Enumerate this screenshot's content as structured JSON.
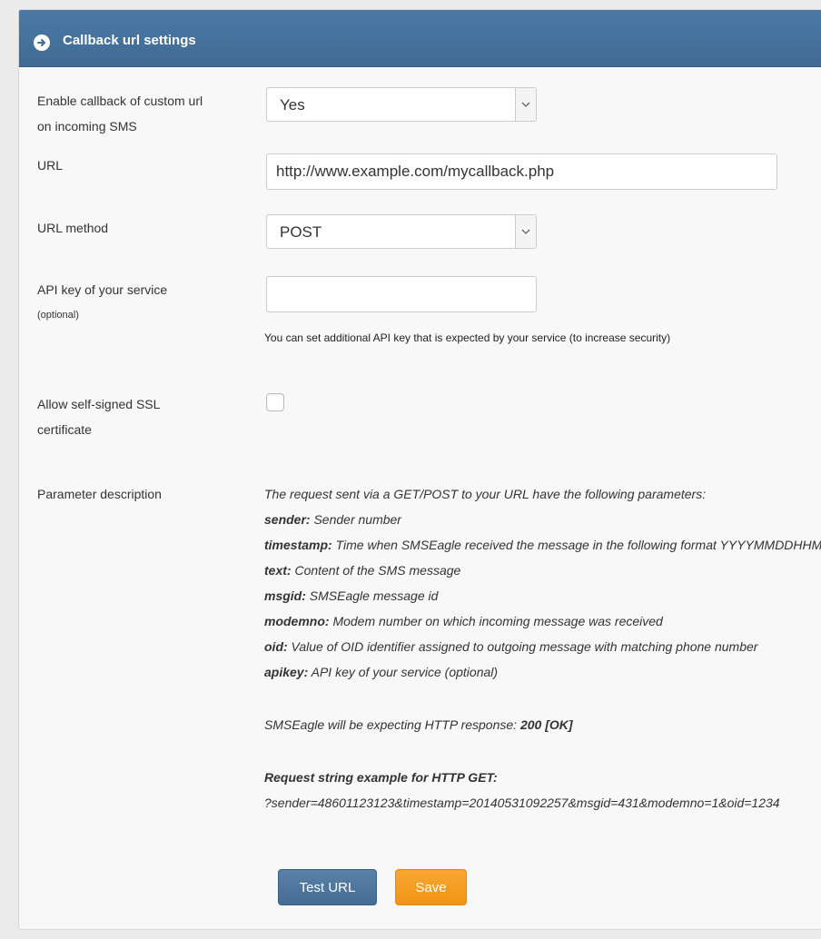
{
  "panel": {
    "title": "Callback url settings",
    "header_icon": "arrow-circle-right-icon"
  },
  "form": {
    "enable_callback": {
      "label_line1": "Enable callback of custom url",
      "label_line2": "on incoming SMS",
      "value": "Yes"
    },
    "url": {
      "label": "URL",
      "value": "http://www.example.com/mycallback.php"
    },
    "url_method": {
      "label": "URL method",
      "value": "POST"
    },
    "api_key": {
      "label": "API key of your service",
      "sublabel": "(optional)",
      "value": "",
      "help": "You can set additional API key that is expected by your service (to increase security)"
    },
    "self_signed": {
      "label_line1": "Allow self-signed SSL",
      "label_line2": "certificate",
      "checked": false
    },
    "parameter_description": {
      "label": "Parameter description",
      "intro": "The request sent via a GET/POST to your URL have the following parameters:",
      "params": [
        {
          "name": "sender:",
          "desc": " Sender number"
        },
        {
          "name": "timestamp:",
          "desc": " Time when SMSEagle received the message in the following format YYYYMMDDHHMMSS"
        },
        {
          "name": "text:",
          "desc": " Content of the SMS message"
        },
        {
          "name": "msgid:",
          "desc": " SMSEagle message id"
        },
        {
          "name": "modemno:",
          "desc": " Modem number on which incoming message was received"
        },
        {
          "name": "oid:",
          "desc": " Value of OID identifier assigned to outgoing message with matching phone number"
        },
        {
          "name": "apikey:",
          "desc": " API key of your service (optional)"
        }
      ],
      "response_prefix": "SMSEagle will be expecting HTTP response: ",
      "response_value": "200 [OK]",
      "example_title": "Request string example for HTTP GET:",
      "example_string": "?sender=48601123123&timestamp=20140531092257&msgid=431&modemno=1&oid=1234"
    }
  },
  "buttons": {
    "test": "Test URL",
    "save": "Save"
  },
  "colors": {
    "header": "#4470a0",
    "primary": "#4e759d",
    "warning": "#f39c12"
  }
}
